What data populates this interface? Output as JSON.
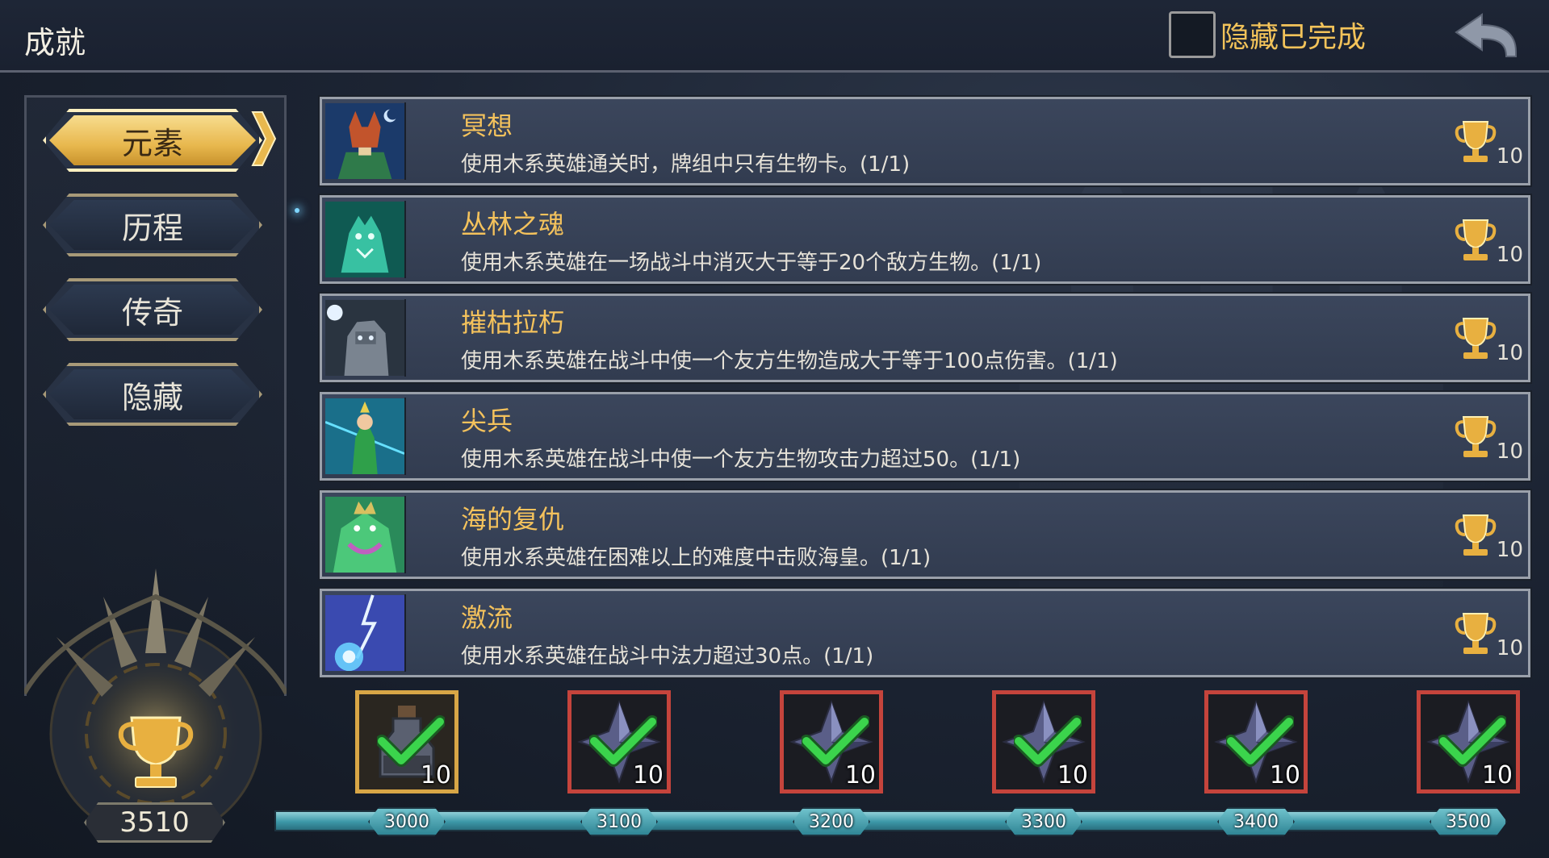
{
  "header": {
    "title": "成就",
    "hide_completed_label": "隐藏已完成",
    "hide_completed_checked": false,
    "back_icon": "back-arrow-icon"
  },
  "sidebar": {
    "categories": [
      {
        "label": "元素",
        "active": true
      },
      {
        "label": "历程",
        "active": false
      },
      {
        "label": "传奇",
        "active": false
      },
      {
        "label": "隐藏",
        "active": false
      }
    ],
    "total_points": "3510"
  },
  "achievements": [
    {
      "title": "冥想",
      "desc": "使用木系英雄通关时，牌组中只有生物卡。(1/1)",
      "points": "10",
      "icon": "fox-hero-portrait"
    },
    {
      "title": "丛林之魂",
      "desc": "使用木系英雄在一场战斗中消灭大于等于20个敌方生物。(1/1)",
      "points": "10",
      "icon": "spirit-wolf-portrait"
    },
    {
      "title": "摧枯拉朽",
      "desc": "使用木系英雄在战斗中使一个友方生物造成大于等于100点伤害。(1/1)",
      "points": "10",
      "icon": "stone-golem-portrait"
    },
    {
      "title": "尖兵",
      "desc": "使用木系英雄在战斗中使一个友方生物攻击力超过50。(1/1)",
      "points": "10",
      "icon": "elf-archer-portrait"
    },
    {
      "title": "海的复仇",
      "desc": "使用水系英雄在困难以上的难度中击败海皇。(1/1)",
      "points": "10",
      "icon": "sea-king-portrait"
    },
    {
      "title": "激流",
      "desc": "使用水系英雄在战斗中法力超过30点。(1/1)",
      "points": "10",
      "icon": "lightning-orb-portrait"
    }
  ],
  "rewards": [
    {
      "milestone": "3000",
      "count": "10",
      "item": "potion-bottle",
      "claimed": true
    },
    {
      "milestone": "3100",
      "count": "10",
      "item": "crystal-shard",
      "claimed": true
    },
    {
      "milestone": "3200",
      "count": "10",
      "item": "crystal-shard",
      "claimed": true
    },
    {
      "milestone": "3300",
      "count": "10",
      "item": "crystal-shard",
      "claimed": true
    },
    {
      "milestone": "3400",
      "count": "10",
      "item": "crystal-shard",
      "claimed": true
    },
    {
      "milestone": "3500",
      "count": "10",
      "item": "crystal-shard",
      "claimed": true
    }
  ],
  "colors": {
    "accent_gold": "#f4c25c",
    "panel": "#3b465c",
    "track": "#3c98a8",
    "reward_border": "#c5443c",
    "check": "#37d04a"
  }
}
